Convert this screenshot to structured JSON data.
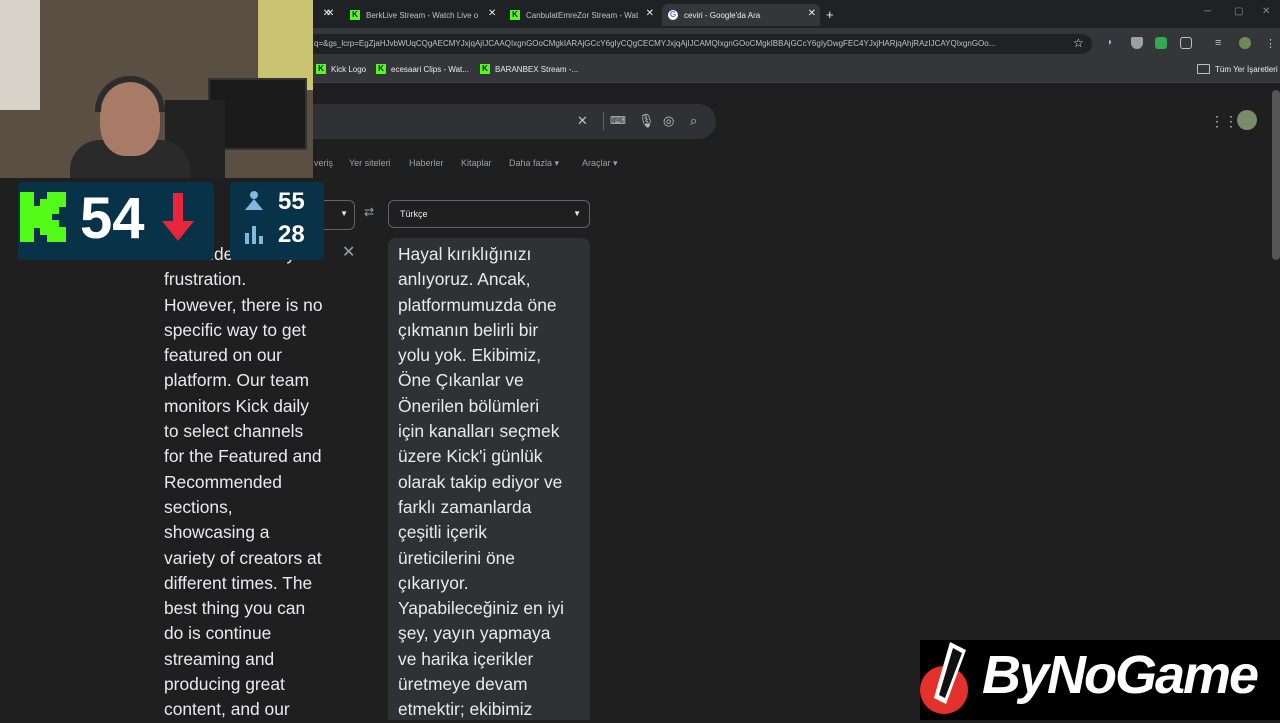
{
  "browser": {
    "tabs": [
      {
        "title": "BerkLive Stream - Watch Live o",
        "favicon": "kick-icon"
      },
      {
        "title": "CanbulatEmreZor Stream - Wat",
        "favicon": "kick-icon"
      },
      {
        "title": "ceviri - Google'da Ara",
        "favicon": "google-icon",
        "active": true
      }
    ],
    "url": "q=&gs_lcrp=EgZjaHJvbWUqCQgAECMYJxjqAjIJCAAQIxgnGOoCMgkIARAjGCcY6gIyCQgCECMYJxjqAjIJCAMQIxgnGOoCMgkIBBAjGCcY6gIyDwgFEC4YJxjHARjqAhjRAzIJCAYQIxgnGOo...",
    "bookmarks": [
      {
        "label": "Kick Logo",
        "favicon": "kick-icon"
      },
      {
        "label": "ecesaari Clips - Wat...",
        "favicon": "kick-icon"
      },
      {
        "label": "BARANBEX Stream -...",
        "favicon": "kick-icon"
      }
    ],
    "bookmarks_folder": "Tüm Yer İşaretleri"
  },
  "google": {
    "nav": [
      "veriş",
      "Yer siteleri",
      "Haberler",
      "Kitaplar",
      "Daha fazla",
      "Araçlar"
    ]
  },
  "translate": {
    "target_language": "Türkçe",
    "source_text": "We understand your\nfrustration.\nHowever, there is no\nspecific way to get\nfeatured on our\nplatform. Our team\nmonitors Kick daily\nto select channels\nfor the Featured and\nRecommended\nsections,\nshowcasing a\nvariety of creators at\ndifferent times. The\nbest thing you can\ndo is continue\nstreaming and\nproducing great\ncontent, and our",
    "target_text": "Hayal kırıklığınızı\nanlıyoruz. Ancak,\nplatformumuzda öne\nçıkmanın belirli bir\nyolu yok. Ekibimiz,\nÖne Çıkanlar ve\nÖnerilen bölümleri\niçin kanalları seçmek\nüzere Kick'i günlük\nolarak takip ediyor ve\nfarklı zamanlarda\nçeşitli içerik\nüreticilerini öne\nçıkarıyor.\nYapabileceğiniz en iyi\nşey, yayın yapmaya\nve harika içerikler\nüretmeye devam\netmektir; ekibimiz"
  },
  "overlay": {
    "viewer_count": "54",
    "stat_top": "55",
    "stat_bottom": "28",
    "brand": "ByNoGame",
    "colors": {
      "kick_green": "#53fc18",
      "badge_bg": "#073247",
      "down_red": "#e8253b",
      "brand_red": "#e4312b"
    }
  }
}
